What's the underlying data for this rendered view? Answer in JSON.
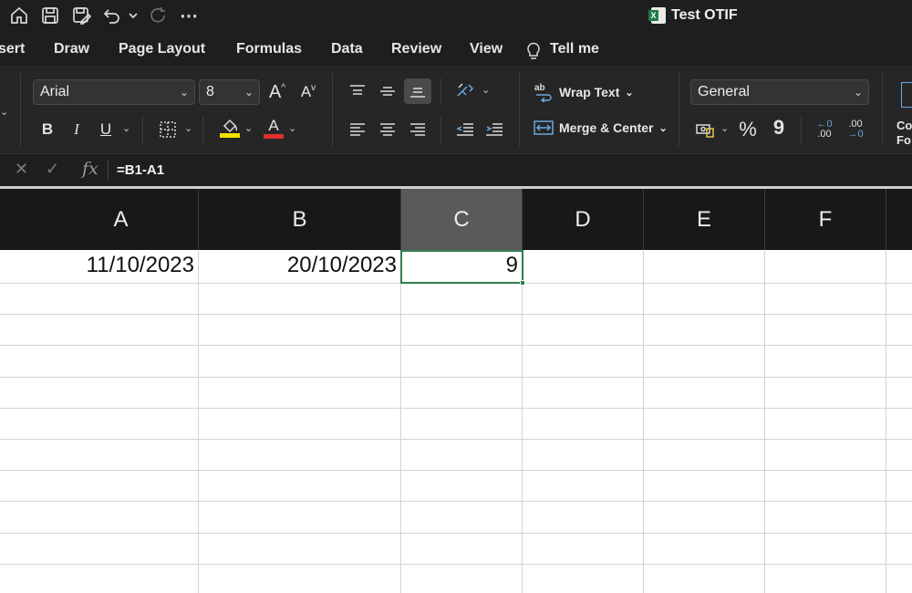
{
  "window": {
    "title": "Test OTIF"
  },
  "quick_access": {
    "icons": [
      "home-icon",
      "save-icon",
      "save-as-icon",
      "undo-icon",
      "undo-dropdown-icon",
      "redo-icon",
      "more-icon"
    ],
    "more_label": "⋯"
  },
  "ribbon_tabs": [
    "sert",
    "Draw",
    "Page Layout",
    "Formulas",
    "Data",
    "Review",
    "View"
  ],
  "tell_me": "Tell me",
  "ribbon": {
    "font_name": "Arial",
    "font_size": "8",
    "bold": "B",
    "italic": "I",
    "underline": "U",
    "increase_font": "A",
    "decrease_font": "A",
    "fill_color": "#f5e100",
    "font_color": "#e0302b",
    "font_color_letter": "A",
    "wrap_text": "Wrap Text",
    "merge_center": "Merge & Center",
    "number_format": "General",
    "percent": "%",
    "comma": "9",
    "increase_decimal": ".00",
    "decrease_decimal": ".00",
    "conditional_partial_1": "Co",
    "conditional_partial_2": "Fo"
  },
  "formula_bar": {
    "cancel": "✕",
    "enter": "✓",
    "fx": "fx",
    "formula": "=B1-A1"
  },
  "sheet": {
    "columns": [
      "A",
      "B",
      "C",
      "D",
      "E",
      "F"
    ],
    "selected_column": "C",
    "active_cell": "C1",
    "row1": {
      "A": "11/10/2023",
      "B": "20/10/2023",
      "C": "9"
    }
  }
}
